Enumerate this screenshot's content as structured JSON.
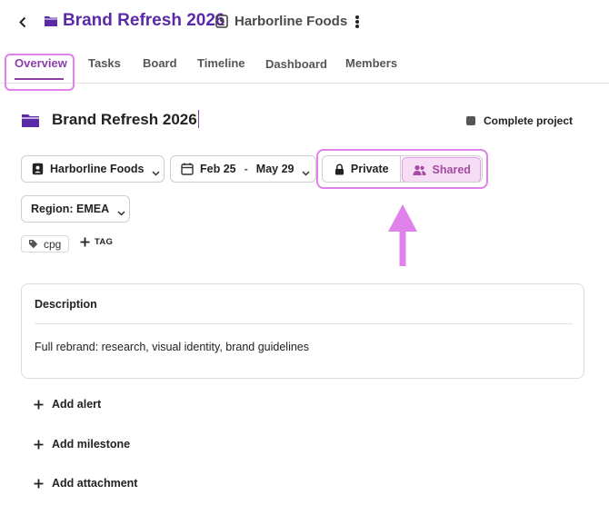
{
  "header": {
    "project_title": "Brand Refresh 2026",
    "client_name": "Harborline Foods"
  },
  "tabs": [
    {
      "label": "Overview",
      "active": true
    },
    {
      "label": "Tasks",
      "active": false
    },
    {
      "label": "Board",
      "active": false
    },
    {
      "label": "Timeline",
      "active": false
    },
    {
      "label": "Dashboard",
      "active": false
    },
    {
      "label": "Members",
      "active": false
    }
  ],
  "project": {
    "title": "Brand Refresh 2026",
    "complete_label": "Complete project"
  },
  "fields": {
    "client": "Harborline Foods",
    "date_start": "Feb 25",
    "date_separator": "-",
    "date_end": "May 29",
    "privacy_private": "Private",
    "privacy_shared": "Shared",
    "privacy_selected": "Shared",
    "region": "Region: EMEA"
  },
  "tags": {
    "items": [
      "cpg"
    ],
    "add_label": "TAG"
  },
  "description": {
    "heading": "Description",
    "text": "Full rebrand: research, visual identity, brand guidelines"
  },
  "actions": {
    "add_alert": "Add alert",
    "add_milestone": "Add milestone",
    "add_attachment": "Add attachment"
  },
  "icons": {
    "back": "chevron-left-icon",
    "folder": "folder-icon",
    "client": "contact-card-icon",
    "more": "kebab-icon",
    "calendar": "calendar-icon",
    "lock": "lock-icon",
    "shared": "users-icon",
    "tag": "tag-icon",
    "add": "plus-icon"
  },
  "colors": {
    "accent": "#5b2aa8",
    "tab_active": "#8b3fa8",
    "shared_bg": "#f6dcf4",
    "highlight": "#e081ec"
  }
}
